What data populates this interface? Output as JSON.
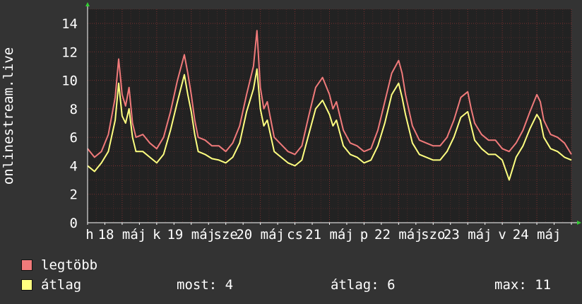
{
  "chart_data": {
    "type": "line",
    "title": "",
    "ylabel": "onlinestream.live",
    "xlabel": "",
    "ylim": [
      0,
      15
    ],
    "yticks": [
      0,
      2,
      4,
      6,
      8,
      10,
      12,
      14
    ],
    "xlim": [
      0,
      7
    ],
    "xtick_labels": [
      {
        "x": 0.03,
        "label": "h"
      },
      {
        "x": 0.5,
        "label": "18 máj"
      },
      {
        "x": 1.0,
        "label": "k"
      },
      {
        "x": 1.5,
        "label": "19 máj"
      },
      {
        "x": 2.0,
        "label": "sze"
      },
      {
        "x": 2.5,
        "label": "20 máj"
      },
      {
        "x": 3.0,
        "label": "cs"
      },
      {
        "x": 3.5,
        "label": "21 máj"
      },
      {
        "x": 4.0,
        "label": "p"
      },
      {
        "x": 4.5,
        "label": "22 máj"
      },
      {
        "x": 5.0,
        "label": "szo"
      },
      {
        "x": 5.5,
        "label": "23 máj"
      },
      {
        "x": 6.0,
        "label": "v"
      },
      {
        "x": 6.5,
        "label": "24 máj"
      }
    ],
    "grid": true,
    "series": [
      {
        "name": "legtöbb",
        "color": "#f07a7a",
        "x": [
          0,
          0.1,
          0.2,
          0.3,
          0.4,
          0.45,
          0.5,
          0.55,
          0.6,
          0.65,
          0.7,
          0.8,
          0.9,
          1.0,
          1.1,
          1.2,
          1.3,
          1.4,
          1.45,
          1.5,
          1.55,
          1.6,
          1.7,
          1.8,
          1.9,
          2.0,
          2.1,
          2.2,
          2.3,
          2.4,
          2.45,
          2.5,
          2.55,
          2.6,
          2.7,
          2.8,
          2.9,
          3.0,
          3.1,
          3.2,
          3.3,
          3.4,
          3.5,
          3.55,
          3.6,
          3.7,
          3.8,
          3.9,
          4.0,
          4.1,
          4.2,
          4.3,
          4.4,
          4.5,
          4.55,
          4.6,
          4.7,
          4.8,
          4.9,
          5.0,
          5.1,
          5.2,
          5.3,
          5.4,
          5.5,
          5.55,
          5.6,
          5.7,
          5.8,
          5.9,
          6.0,
          6.1,
          6.2,
          6.3,
          6.4,
          6.5,
          6.55,
          6.6,
          6.7,
          6.8,
          6.9,
          7.0
        ],
        "values": [
          5.2,
          4.6,
          5.0,
          6.2,
          8.8,
          11.5,
          9.0,
          8.2,
          9.5,
          7.0,
          6.0,
          6.2,
          5.6,
          5.2,
          6.0,
          7.8,
          10.0,
          11.8,
          10.5,
          9.0,
          7.2,
          6.0,
          5.8,
          5.4,
          5.4,
          5.0,
          5.6,
          6.8,
          9.0,
          11.0,
          13.5,
          9.5,
          8.0,
          8.5,
          6.0,
          5.5,
          5.0,
          4.8,
          5.4,
          7.5,
          9.5,
          10.2,
          9.0,
          8.0,
          8.5,
          6.5,
          5.6,
          5.4,
          5.0,
          5.2,
          6.5,
          8.5,
          10.5,
          11.4,
          10.5,
          9.0,
          6.8,
          5.8,
          5.6,
          5.4,
          5.4,
          6.0,
          7.2,
          8.8,
          9.2,
          8.0,
          7.0,
          6.2,
          5.8,
          5.8,
          5.2,
          5.0,
          5.6,
          6.5,
          7.8,
          9.0,
          8.5,
          7.2,
          6.2,
          6.0,
          5.6,
          4.8
        ]
      },
      {
        "name": "átlag",
        "color": "#ffff80",
        "x": [
          0,
          0.1,
          0.2,
          0.3,
          0.4,
          0.45,
          0.5,
          0.55,
          0.6,
          0.65,
          0.7,
          0.8,
          0.9,
          1.0,
          1.1,
          1.2,
          1.3,
          1.4,
          1.45,
          1.5,
          1.55,
          1.6,
          1.7,
          1.8,
          1.9,
          2.0,
          2.1,
          2.2,
          2.3,
          2.4,
          2.45,
          2.5,
          2.55,
          2.6,
          2.7,
          2.8,
          2.9,
          3.0,
          3.1,
          3.2,
          3.3,
          3.4,
          3.5,
          3.55,
          3.6,
          3.7,
          3.8,
          3.9,
          4.0,
          4.1,
          4.2,
          4.3,
          4.4,
          4.5,
          4.55,
          4.6,
          4.7,
          4.8,
          4.9,
          5.0,
          5.1,
          5.2,
          5.3,
          5.4,
          5.5,
          5.55,
          5.6,
          5.7,
          5.8,
          5.9,
          6.0,
          6.1,
          6.2,
          6.3,
          6.4,
          6.5,
          6.55,
          6.6,
          6.7,
          6.8,
          6.9,
          7.0
        ],
        "values": [
          4.0,
          3.6,
          4.2,
          5.0,
          7.2,
          9.8,
          7.5,
          7.0,
          8.0,
          6.0,
          5.0,
          5.0,
          4.6,
          4.2,
          4.8,
          6.5,
          8.5,
          10.4,
          9.0,
          7.8,
          6.2,
          5.0,
          4.8,
          4.5,
          4.4,
          4.2,
          4.6,
          5.6,
          7.8,
          9.4,
          10.8,
          8.0,
          6.8,
          7.2,
          5.0,
          4.6,
          4.2,
          4.0,
          4.4,
          6.2,
          8.0,
          8.6,
          7.6,
          6.8,
          7.2,
          5.4,
          4.8,
          4.6,
          4.2,
          4.4,
          5.4,
          7.0,
          9.0,
          9.8,
          8.8,
          7.6,
          5.6,
          4.8,
          4.6,
          4.4,
          4.4,
          5.0,
          6.0,
          7.4,
          7.8,
          6.8,
          5.8,
          5.2,
          4.8,
          4.8,
          4.4,
          3.0,
          4.6,
          5.4,
          6.6,
          7.6,
          7.2,
          6.0,
          5.2,
          5.0,
          4.6,
          4.4
        ]
      }
    ]
  },
  "legend": {
    "max_label": "legtöbb",
    "avg_label": "átlag",
    "max_color": "#f07a7a",
    "avg_color": "#ffff80"
  },
  "stats": {
    "now": "most: 4",
    "avg": "átlag: 6",
    "max": "max: 11"
  }
}
